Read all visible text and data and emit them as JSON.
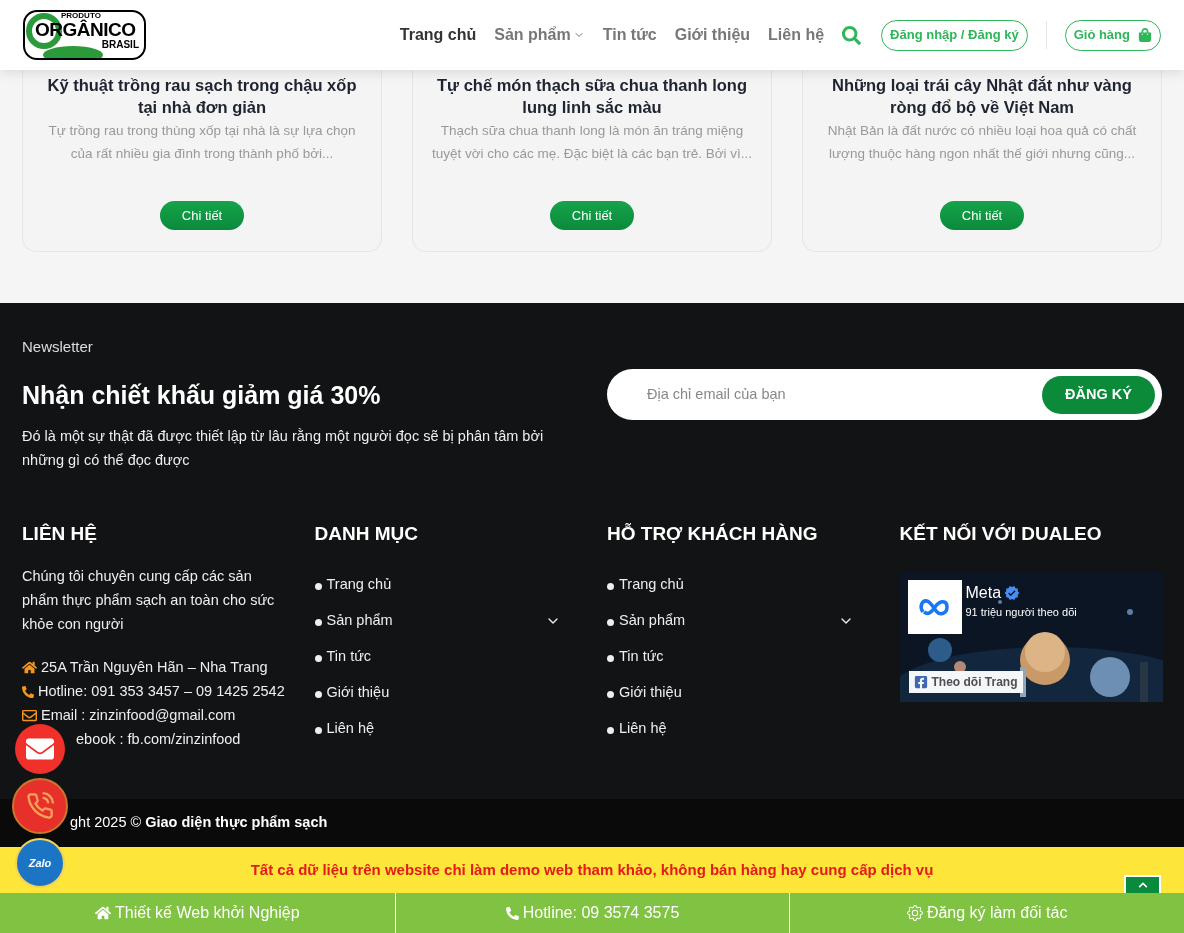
{
  "header": {
    "logo": {
      "top": "PRODUTO",
      "main": "ORGÂNICO",
      "sub": "BRASIL"
    },
    "nav": [
      {
        "label": "Trang chủ",
        "selected": true,
        "dropdown": false
      },
      {
        "label": "Sản phẩm",
        "selected": false,
        "dropdown": true
      },
      {
        "label": "Tin tức",
        "selected": false,
        "dropdown": false
      },
      {
        "label": "Giới thiệu",
        "selected": false,
        "dropdown": false
      },
      {
        "label": "Liên hệ",
        "selected": false,
        "dropdown": false
      }
    ],
    "login": "Đăng nhập / Đăng ký",
    "cart": "Giỏ hàng"
  },
  "posts": [
    {
      "title": "Kỹ thuật trồng rau sạch trong chậu xốp tại nhà đơn giản",
      "excerpt": "Tự trồng rau trong thùng xốp tại nhà là sự lựa chọn của rất nhiều gia đình trong thành phố bởi...",
      "button": "Chi tiết"
    },
    {
      "title": "Tự chế món thạch sữa chua thanh long lung linh sắc màu",
      "excerpt": "Thạch sữa chua thanh long là món ăn tráng miệng tuyệt vời cho các mẹ. Đặc biệt là các bạn trẻ. Bởi vì...",
      "button": "Chi tiết"
    },
    {
      "title": "Những loại trái cây Nhật đắt như vàng ròng đổ bộ về Việt Nam",
      "excerpt": "Nhật Bản là đất nước có nhiều loại hoa quả có chất lượng thuộc hàng ngon nhất thế giới nhưng cũng...",
      "button": "Chi tiết"
    }
  ],
  "newsletter": {
    "eyebrow": "Newsletter",
    "title": "Nhận chiết khấu giảm giá 30%",
    "text": "Đó là một sự thật đã được thiết lập từ lâu rằng một người đọc sẽ bị phân tâm bởi những gì có thể đọc được",
    "placeholder": "Địa chỉ email của bạn",
    "button": "ĐĂNG KÝ"
  },
  "contact": {
    "title": "LIÊN HỆ",
    "text": "Chúng tôi chuyên cung cấp các sản phẩm thực phẩm sạch an toàn cho sức khỏe con người",
    "lines": [
      {
        "kind": "address",
        "text": "25A Trần Nguyên Hãn – Nha Trang"
      },
      {
        "kind": "phone",
        "text": "Hotline: 091 353 3457 – 09 1425 2542"
      },
      {
        "kind": "email",
        "text": "Email : zinzinfood@gmail.com"
      },
      {
        "kind": "facebook",
        "text": "ebook : fb.com/zinzinfood"
      }
    ]
  },
  "menus": [
    {
      "title": "DANH MỤC",
      "items": [
        {
          "label": "Trang chủ",
          "expandable": false
        },
        {
          "label": "Sản phẩm",
          "expandable": true
        },
        {
          "label": "Tin tức",
          "expandable": false
        },
        {
          "label": "Giới thiệu",
          "expandable": false
        },
        {
          "label": "Liên hệ",
          "expandable": false
        }
      ]
    },
    {
      "title": "HỖ TRỢ KHÁCH HÀNG",
      "items": [
        {
          "label": "Trang chủ",
          "expandable": false
        },
        {
          "label": "Sản phẩm",
          "expandable": true
        },
        {
          "label": "Tin tức",
          "expandable": false
        },
        {
          "label": "Giới thiệu",
          "expandable": false
        },
        {
          "label": "Liên hệ",
          "expandable": false
        }
      ]
    }
  ],
  "connect": {
    "title": "KẾT NỐI VỚI DUALEO",
    "page_name": "Meta",
    "followers": "91 triệu người theo dõi",
    "follow_button": "Theo dõi Trang"
  },
  "copyright": "ght 2025 © **Giao diện thực phẩm sạch**",
  "notice": "Tất cả dữ liệu trên website chỉ làm demo web tham khảo, không bán hàng hay cung cấp dịch vụ",
  "bottom_bar": [
    {
      "kind": "home",
      "label": "Thiết kế Web khởi Nghiệp"
    },
    {
      "kind": "phone",
      "label": "Hotline: 09 3574 3575"
    },
    {
      "kind": "gear",
      "label": "Đăng ký làm đối tác"
    }
  ],
  "floating": [
    {
      "kind": "mail"
    },
    {
      "kind": "phone"
    },
    {
      "kind": "zalo",
      "label": "Zalo"
    }
  ]
}
